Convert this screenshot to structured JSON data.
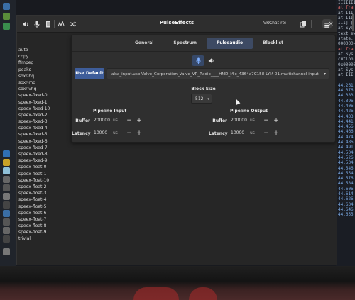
{
  "window": {
    "title": "PulseEffects",
    "preset": "VRChat-rei"
  },
  "headerbar_icons": [
    "speaker-icon",
    "microphone-icon",
    "page-icon",
    "chart-icon",
    "shuffle-icon",
    "copy-icon",
    "menu-icon",
    "close-icon"
  ],
  "resampler_list": [
    "auto",
    "copy",
    "ffmpeg",
    "peaks",
    "soxr-hq",
    "soxr-mq",
    "soxr-vhq",
    "speex-fixed-0",
    "speex-fixed-1",
    "speex-fixed-10",
    "speex-fixed-2",
    "speex-fixed-3",
    "speex-fixed-4",
    "speex-fixed-5",
    "speex-fixed-6",
    "speex-fixed-7",
    "speex-fixed-8",
    "speex-fixed-9",
    "speex-float-0",
    "speex-float-1",
    "speex-float-10",
    "speex-float-2",
    "speex-float-3",
    "speex-float-4",
    "speex-float-5",
    "speex-float-6",
    "speex-float-7",
    "speex-float-8",
    "speex-float-9",
    "trivial"
  ],
  "tabs": [
    "General",
    "Spectrum",
    "Pulseaudio",
    "Blocklist"
  ],
  "active_tab": "Pulseaudio",
  "pulseaudio": {
    "use_default_label": "Use Default",
    "input_device": "alsa_input.usb-Valve_Corporation_Valve_VR_Radio____HMD_Mic_4364a7C158-LYM-01.multichannel-input",
    "block_size_label": "Block Size",
    "block_size_value": "512",
    "pipeline_input": {
      "title": "Pipeline Input",
      "buffer_label": "Buffer",
      "buffer_value": "200000",
      "latency_label": "Latency",
      "latency_value": "10000",
      "unit": "us"
    },
    "pipeline_output": {
      "title": "Pipeline Output",
      "buffer_label": "Buffer",
      "buffer_value": "200000",
      "latency_label": "Latency",
      "latency_value": "10000",
      "unit": "us"
    }
  },
  "terminal_lines": [
    {
      "text": "IIIIIII",
      "cls": ""
    },
    {
      "text": "at Tra",
      "cls": "red"
    },
    {
      "text": "at III",
      "cls": ""
    },
    {
      "text": "at III",
      "cls": ""
    },
    {
      "text": "III] [",
      "cls": ""
    },
    {
      "text": "at Sys",
      "cls": ""
    },
    {
      "text": "text ew",
      "cls": ""
    },
    {
      "text": "state,",
      "cls": ""
    },
    {
      "text": "000000-",
      "cls": ""
    },
    {
      "text": "at Tra",
      "cls": "red"
    },
    {
      "text": "at Sys",
      "cls": ""
    },
    {
      "text": "cution",
      "cls": ""
    },
    {
      "text": "0x00000",
      "cls": ""
    },
    {
      "text": "at Sys",
      "cls": ""
    },
    {
      "text": "at III",
      "cls": ""
    },
    {
      "text": "",
      "cls": ""
    },
    {
      "text": "44.261",
      "cls": "blue"
    },
    {
      "text": "44.376",
      "cls": "blue"
    },
    {
      "text": "44.383",
      "cls": "blue"
    },
    {
      "text": "44.396",
      "cls": "blue"
    },
    {
      "text": "44.406",
      "cls": "blue"
    },
    {
      "text": "44.426",
      "cls": "blue"
    },
    {
      "text": "44.433",
      "cls": "blue"
    },
    {
      "text": "44.441",
      "cls": "blue"
    },
    {
      "text": "44.456",
      "cls": "blue"
    },
    {
      "text": "44.466",
      "cls": "blue"
    },
    {
      "text": "44.474",
      "cls": "blue"
    },
    {
      "text": "44.486",
      "cls": "blue"
    },
    {
      "text": "44.491",
      "cls": "blue"
    },
    {
      "text": "44.504",
      "cls": "blue"
    },
    {
      "text": "44.526",
      "cls": "blue"
    },
    {
      "text": "44.534",
      "cls": "blue"
    },
    {
      "text": "44.546",
      "cls": "blue"
    },
    {
      "text": "44.554",
      "cls": "blue"
    },
    {
      "text": "44.576",
      "cls": "blue"
    },
    {
      "text": "44.584",
      "cls": "blue"
    },
    {
      "text": "44.606",
      "cls": "blue"
    },
    {
      "text": "44.614",
      "cls": "blue"
    },
    {
      "text": "44.626",
      "cls": "blue"
    },
    {
      "text": "44.634",
      "cls": "blue"
    },
    {
      "text": "44.646",
      "cls": "blue"
    },
    {
      "text": "44.655",
      "cls": "blue"
    }
  ]
}
